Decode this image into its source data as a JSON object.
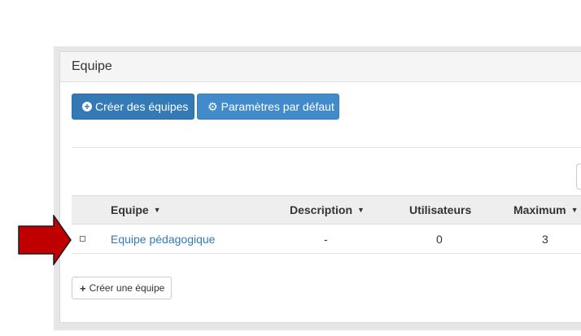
{
  "panel": {
    "title": "Equipe"
  },
  "toolbar": {
    "create_teams_label": "Créer des équipes",
    "default_settings_label": "Paramètres par défaut"
  },
  "table": {
    "columns": [
      {
        "label": "Equipe",
        "sortable": true
      },
      {
        "label": "Description",
        "sortable": true
      },
      {
        "label": "Utilisateurs",
        "sortable": false
      },
      {
        "label": "Maximum",
        "sortable": true
      }
    ],
    "rows": [
      {
        "name": "Equipe pédagogique",
        "description": "-",
        "users": "0",
        "maximum": "3"
      }
    ]
  },
  "footer": {
    "create_team_label": "Créer une équipe"
  },
  "sort_caret": "▼",
  "colors": {
    "primary_dark": "#337ab7",
    "primary": "#428bca",
    "link": "#337ab7",
    "annotation_arrow": "#c00000"
  },
  "icons": {
    "create_teams": "plus-circle-icon",
    "default_settings": "gear-icon",
    "create_team": "plus-icon",
    "annotation": "red-arrow-icon"
  }
}
